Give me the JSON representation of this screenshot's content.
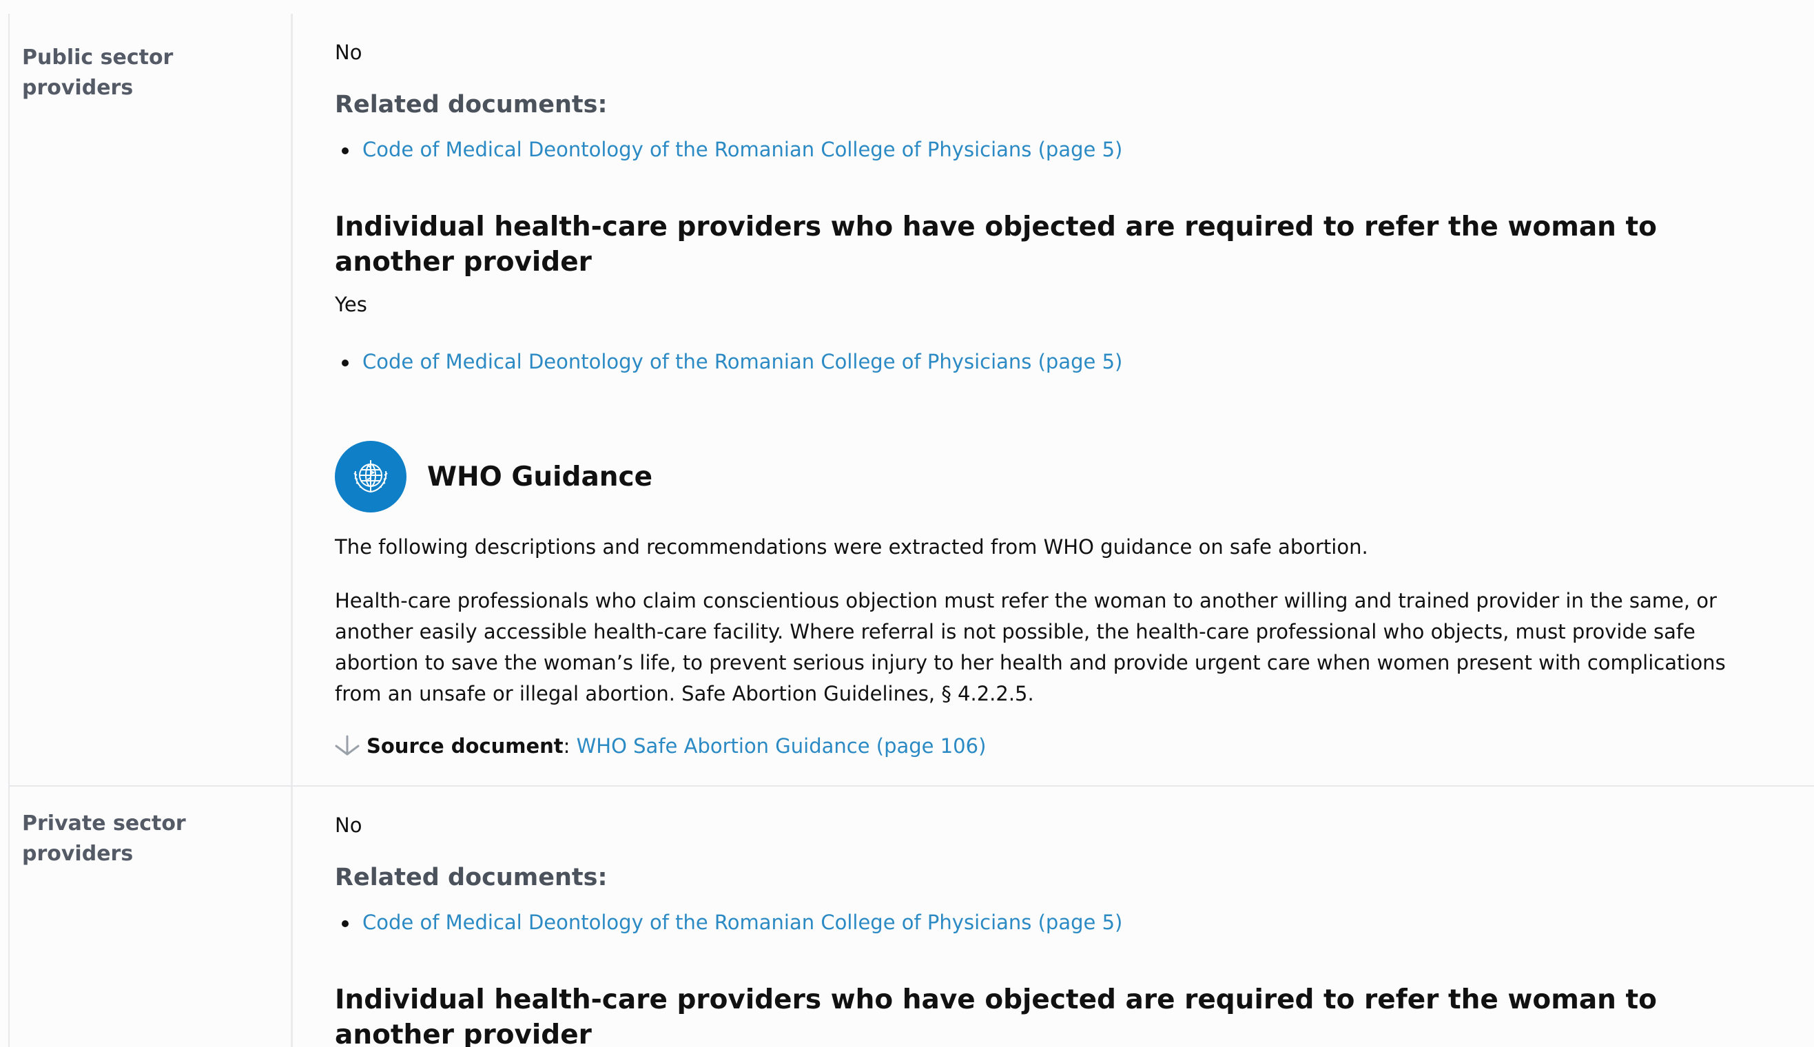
{
  "sections": [
    {
      "label": "Public sector providers",
      "answer": "No",
      "related_heading": "Related documents:",
      "related_docs": [
        "Code of Medical Deontology of the Romanian College of Physicians (page 5)"
      ],
      "question": "Individual health-care providers who have objected are required to refer the woman to another provider",
      "question_answer": "Yes",
      "question_docs": [
        "Code of Medical Deontology of the Romanian College of Physicians (page 5)"
      ],
      "who": {
        "title": "WHO Guidance",
        "intro": "The following descriptions and recommendations were extracted from WHO guidance on safe abortion.",
        "body": "Health-care professionals who claim conscientious objection must refer the woman to another willing and trained provider in the same, or another easily accessible health-care facility. Where referral is not possible, the health-care professional who objects, must provide safe abortion to save the woman’s life, to prevent serious injury to her health and provide urgent care when women present with complications from an unsafe or illegal abortion. Safe Abortion Guidelines, § 4.2.2.5.",
        "source_label": "Source document",
        "source_sep": ":",
        "source_link": "WHO Safe Abortion Guidance (page 106)"
      }
    },
    {
      "label": "Private sector providers",
      "answer": "No",
      "related_heading": "Related documents:",
      "related_docs": [
        "Code of Medical Deontology of the Romanian College of Physicians (page 5)"
      ],
      "question": "Individual health-care providers who have objected are required to refer the woman to another provider"
    }
  ],
  "icons": {
    "who_logo": "who-emblem-icon",
    "source_arrow": "arrow-down-icon"
  },
  "colors": {
    "link": "#2b8ac4",
    "who_blue": "#0f7fc8",
    "label_gray": "#545b66"
  }
}
